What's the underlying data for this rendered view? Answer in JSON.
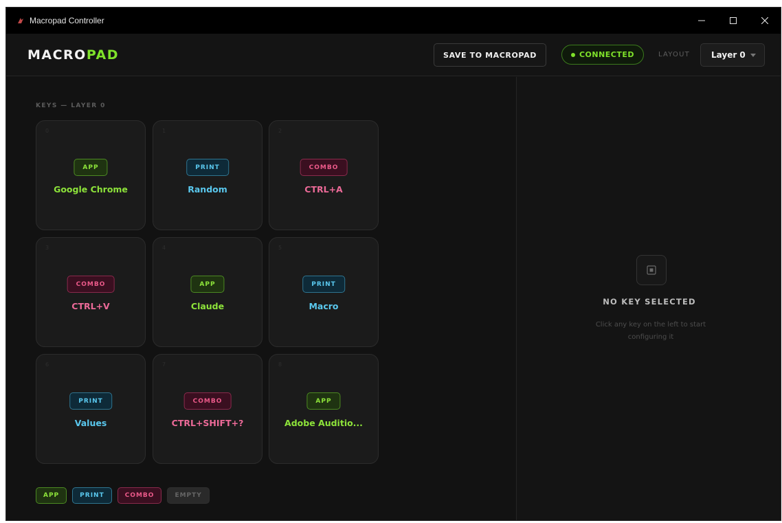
{
  "window": {
    "title": "Macropad Controller"
  },
  "header": {
    "logo_part1": "MACRO",
    "logo_part2": "PAD",
    "save_label": "SAVE TO MACROPAD",
    "status_label": "CONNECTED",
    "layout_label": "LAYOUT",
    "layer_value": "Layer 0"
  },
  "keys_section": {
    "title": "KEYS — LAYER 0",
    "keys": [
      {
        "index": "0",
        "type": "APP",
        "label": "Google Chrome"
      },
      {
        "index": "1",
        "type": "PRINT",
        "label": "Random"
      },
      {
        "index": "2",
        "type": "COMBO",
        "label": "CTRL+A"
      },
      {
        "index": "3",
        "type": "COMBO",
        "label": "CTRL+V"
      },
      {
        "index": "4",
        "type": "APP",
        "label": "Claude"
      },
      {
        "index": "5",
        "type": "PRINT",
        "label": "Macro"
      },
      {
        "index": "6",
        "type": "PRINT",
        "label": "Values"
      },
      {
        "index": "7",
        "type": "COMBO",
        "label": "CTRL+SHIFT+?"
      },
      {
        "index": "8",
        "type": "APP",
        "label": "Adobe Auditio..."
      }
    ]
  },
  "legend": {
    "app": "APP",
    "print": "PRINT",
    "combo": "COMBO",
    "empty": "EMPTY"
  },
  "detail_panel": {
    "title": "NO KEY SELECTED",
    "subtitle": "Click any key on the left to start configuring it"
  },
  "colors": {
    "accent_green": "#7fe22a",
    "print_blue": "#5ac8ee",
    "combo_pink": "#ec5a8a"
  }
}
